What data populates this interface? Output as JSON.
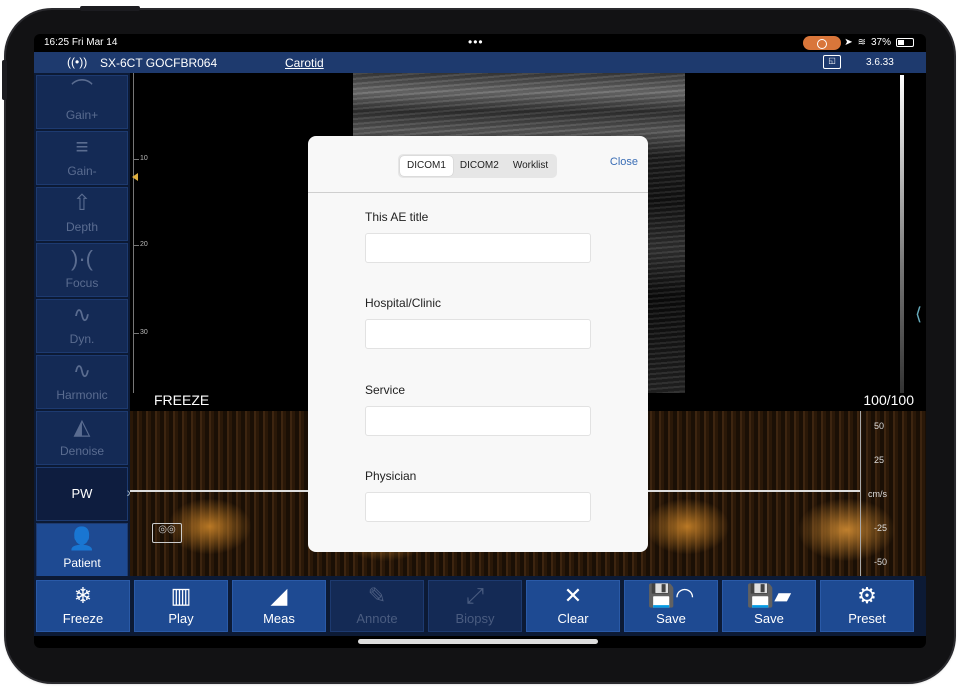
{
  "status": {
    "time": "16:25",
    "date": "Fri Mar 14",
    "battery": "37%"
  },
  "header": {
    "probe": "SX-6CT GOCFBR064",
    "preset": "Carotid",
    "version": "3.6.33"
  },
  "sidebar": {
    "items": [
      {
        "label": "Gain+",
        "icon": "gain-up-icon"
      },
      {
        "label": "Gain-",
        "icon": "gain-down-icon"
      },
      {
        "label": "Depth",
        "icon": "depth-icon"
      },
      {
        "label": "Focus",
        "icon": "focus-icon"
      },
      {
        "label": "Dyn.",
        "icon": "dynamic-range-icon"
      },
      {
        "label": "Harmonic",
        "icon": "harmonic-icon"
      },
      {
        "label": "Denoise",
        "icon": "denoise-icon"
      },
      {
        "label": "PW",
        "icon": ""
      },
      {
        "label": "Patient",
        "icon": "patient-icon"
      }
    ]
  },
  "image": {
    "depth_ticks": [
      "10",
      "20",
      "30"
    ],
    "freeze_label": "FREEZE",
    "gain_value": "100/100",
    "velocity_scale": [
      "50",
      "25",
      "cm/s",
      "-25",
      "-50"
    ]
  },
  "toolbar": {
    "buttons": [
      {
        "label": "Freeze",
        "enabled": true
      },
      {
        "label": "Play",
        "enabled": true
      },
      {
        "label": "Meas",
        "enabled": true
      },
      {
        "label": "Annote",
        "enabled": false
      },
      {
        "label": "Biopsy",
        "enabled": false
      },
      {
        "label": "Clear",
        "enabled": true
      },
      {
        "label": "Save",
        "enabled": true
      },
      {
        "label": "Save",
        "enabled": true
      },
      {
        "label": "Preset",
        "enabled": true
      }
    ]
  },
  "dialog": {
    "tabs": [
      "DICOM1",
      "DICOM2",
      "Worklist"
    ],
    "active_tab": "DICOM1",
    "close_label": "Close",
    "fields": [
      {
        "label": "This AE title",
        "value": "",
        "placeholder": ""
      },
      {
        "label": "Hospital/Clinic",
        "value": "",
        "placeholder": ""
      },
      {
        "label": "Service",
        "value": "",
        "placeholder": ""
      },
      {
        "label": "Physician",
        "value": "",
        "placeholder": ""
      }
    ]
  }
}
